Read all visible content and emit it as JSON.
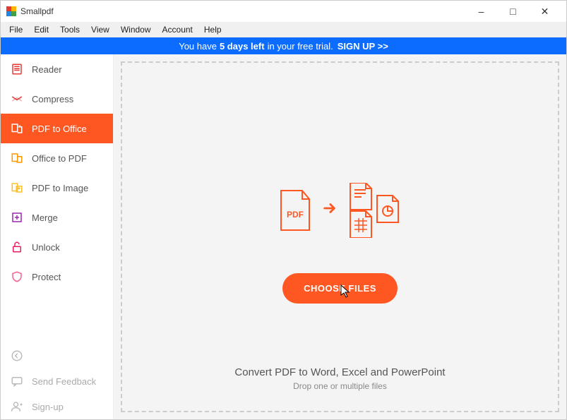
{
  "window": {
    "title": "Smallpdf"
  },
  "menubar": [
    "File",
    "Edit",
    "Tools",
    "View",
    "Window",
    "Account",
    "Help"
  ],
  "banner": {
    "pre": "You have",
    "days": "5 days left",
    "post": "in your free trial.",
    "signup": "SIGN UP >>"
  },
  "sidebar": {
    "items": [
      {
        "label": "Reader",
        "icon": "reader-icon",
        "color": "#e53935"
      },
      {
        "label": "Compress",
        "icon": "compress-icon",
        "color": "#e53935"
      },
      {
        "label": "PDF to Office",
        "icon": "pdf-to-office-icon",
        "color": "#ffffff",
        "selected": true
      },
      {
        "label": "Office to PDF",
        "icon": "office-to-pdf-icon",
        "color": "#ff9800"
      },
      {
        "label": "PDF to Image",
        "icon": "pdf-to-image-icon",
        "color": "#fbc02d"
      },
      {
        "label": "Merge",
        "icon": "merge-icon",
        "color": "#9c27b0"
      },
      {
        "label": "Unlock",
        "icon": "unlock-icon",
        "color": "#e91e63"
      },
      {
        "label": "Protect",
        "icon": "protect-icon",
        "color": "#f06292"
      }
    ],
    "footer": [
      {
        "label": "",
        "icon": "back-icon"
      },
      {
        "label": "Send Feedback",
        "icon": "feedback-icon"
      },
      {
        "label": "Sign-up",
        "icon": "signup-icon"
      }
    ]
  },
  "main": {
    "choose_btn": "CHOOSE FILES",
    "caption_heading": "Convert PDF to Word, Excel and PowerPoint",
    "caption_sub": "Drop one or multiple files",
    "pdf_label": "PDF"
  }
}
